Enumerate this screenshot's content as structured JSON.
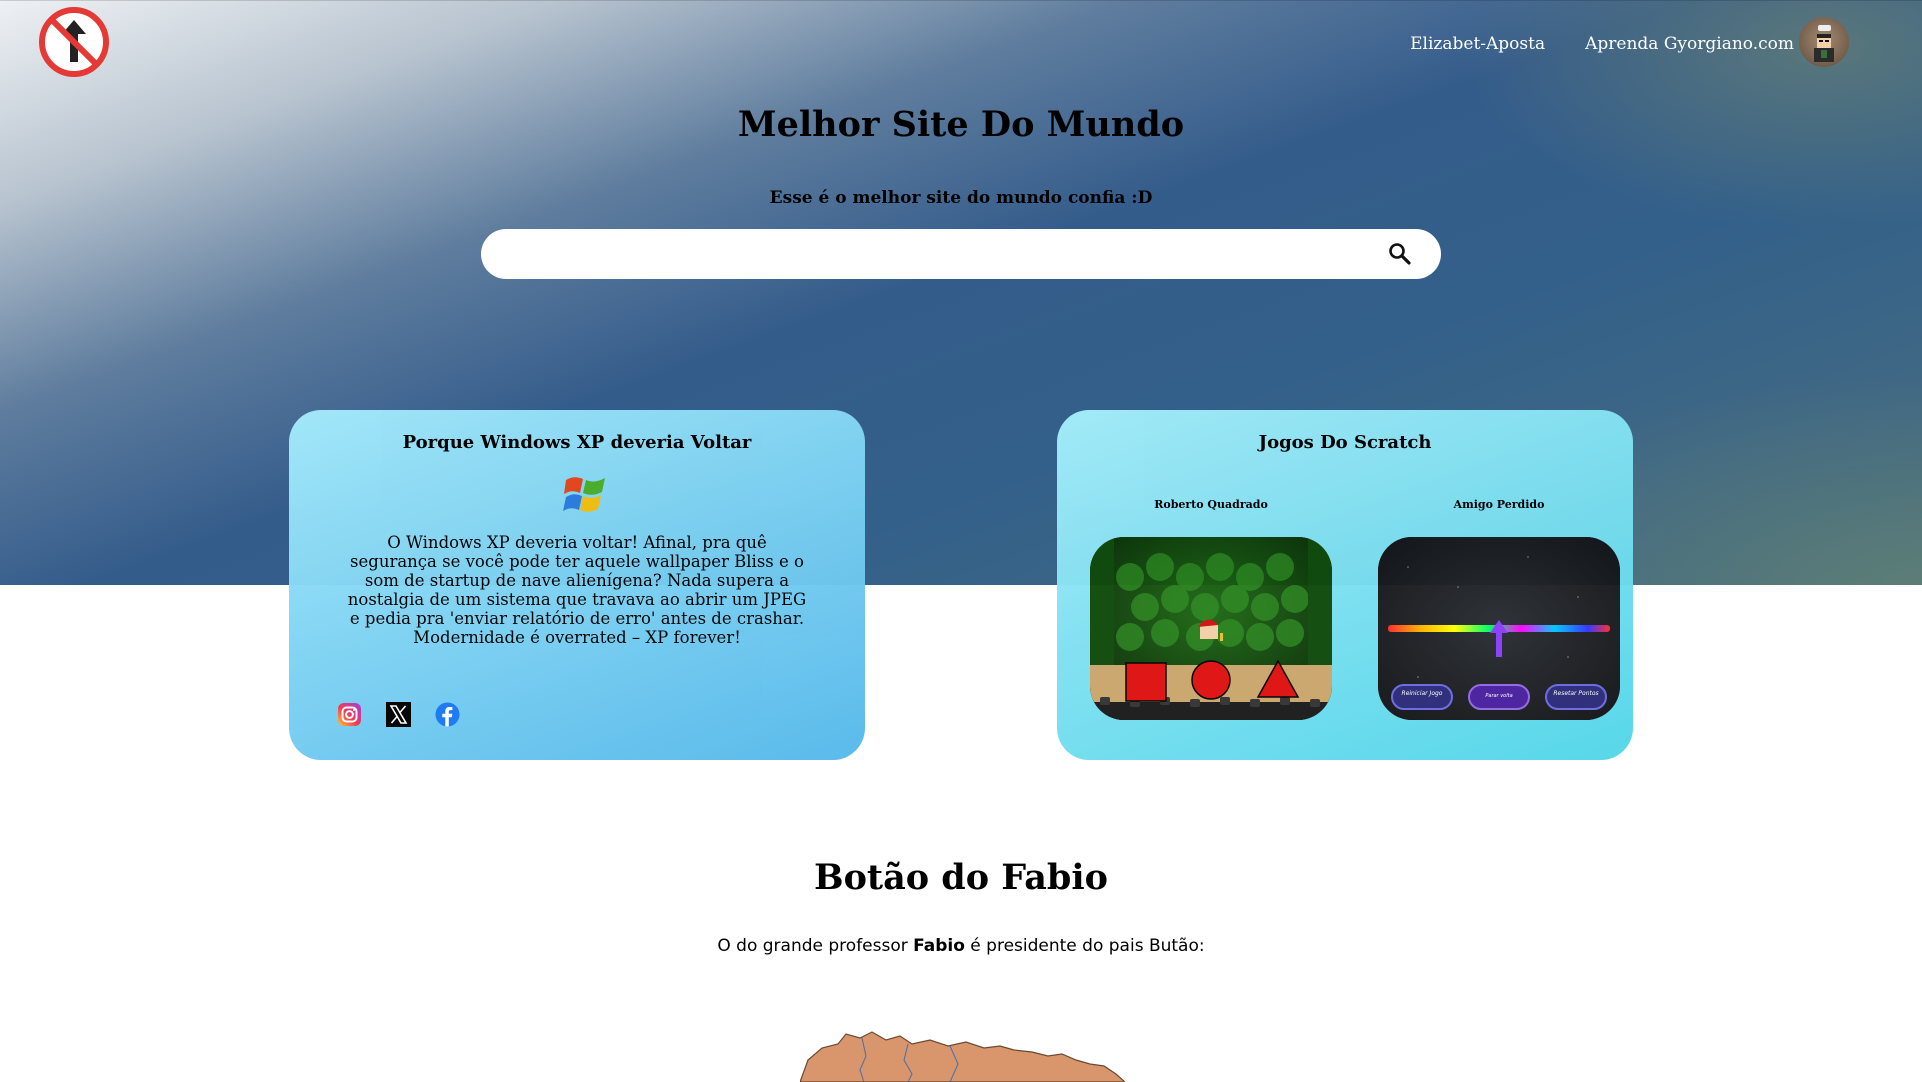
{
  "header": {
    "nav": [
      "Elizabet-Aposta",
      "Aprenda Gyorgiano.com"
    ],
    "title": "Melhor Site Do Mundo",
    "subtitle": "Esse é o melhor site do mundo confia :D",
    "search_placeholder": ""
  },
  "card_xp": {
    "title": "Porque Windows XP deveria Voltar",
    "text": "O Windows XP deveria voltar! Afinal, pra quê segurança se você pode ter aquele wallpaper Bliss e o som de startup de nave alienígena? Nada supera a nostalgia de um sistema que travava ao abrir um JPEG e pedia pra 'enviar relatório de erro' antes de crashar. Modernidade é overrated – XP forever!",
    "socials": [
      "instagram-icon",
      "x-icon",
      "facebook-icon"
    ]
  },
  "card_scratch": {
    "title": "Jogos Do Scratch",
    "games": [
      {
        "label": "Roberto Quadrado"
      },
      {
        "label": "Amigo Perdido",
        "buttons": [
          "Reiniciar Jogo",
          "Parar volta",
          "Resetar Pontos"
        ]
      }
    ]
  },
  "section": {
    "title": "Botão do Fabio",
    "text_before": "O do grande professor ",
    "text_bold": "Fabio",
    "text_after": " é presidente do pais Butão:"
  },
  "colors": {
    "card_left": "#7fd3f3",
    "card_right": "#7fe0f1",
    "no_entry_red": "#e53935"
  }
}
